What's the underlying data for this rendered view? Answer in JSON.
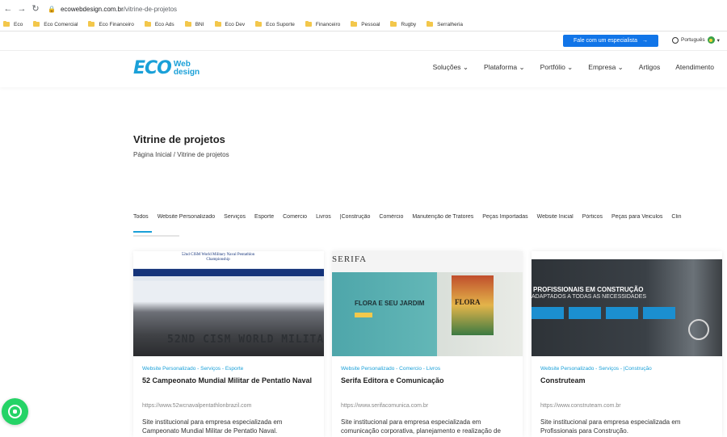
{
  "browser": {
    "url_host": "ecowebdesign.com.br",
    "url_path": "/vitrine-de-projetos",
    "bookmarks": [
      "Eco",
      "Eco Comercial",
      "Eco Financeiro",
      "Eco Ads",
      "BNI",
      "Eco Dev",
      "Eco Suporte",
      "Financeiro",
      "Pessoal",
      "Rugby",
      "Serralheria"
    ]
  },
  "utilbar": {
    "cta_label": "Fale com um especialista",
    "cta_arrow": "→",
    "language": "Português",
    "chevron": "▾"
  },
  "brand": {
    "logo_main": "ECO",
    "logo_line1": "Web",
    "logo_line2": "design",
    "accent_color": "#1aa0d8"
  },
  "menu": [
    "Soluções ⌄",
    "Plataforma ⌄",
    "Portfólio ⌄",
    "Empresa ⌄",
    "Artigos",
    "Atendimento"
  ],
  "page": {
    "title": "Vitrine de projetos",
    "breadcrumb": "Página Inicial / Vitrine de projetos"
  },
  "filters": [
    "Todos",
    "Website Personalizado",
    "Serviços",
    "Esporte",
    "Comercio",
    "Livros",
    "|Construção",
    "Comércio",
    "Manutenção de Tratores",
    "Peças Importadas",
    "Website Inicial",
    "Pórticos",
    "Peças para Veiculos",
    "Clin"
  ],
  "cards": [
    {
      "categories": "Website Personalizado - Serviços - Esporte",
      "title": "52 Campeonato Mundial Militar de Pentatlo Naval",
      "url": "https://www.52wcnavalpentathlonbrazil.com",
      "description": "Site institucional para empresa especializada em Campeonato Mundial Militar de Pentatlo Naval.",
      "image": {
        "banner": "52nd CISM World Military Naval Pentathlon Championship",
        "big_text": "52ND CISM WORLD MILITA"
      }
    },
    {
      "categories": "Website Personalizado - Comercio - Livros",
      "title": "Serifa Editora e Comunicação",
      "url": "https://www.serifacomunica.com.br",
      "description": "Site institucional para empresa especializada em comunicação corporativa, planejamento e realização de eventos e edição de livros e revistas.",
      "image": {
        "logo": "SERIFA",
        "headline": "FLORA E SEU JARDIM",
        "poster": "FLORA"
      }
    },
    {
      "categories": "Website Personalizado - Serviços - |Construção",
      "title": "Construteam",
      "url": "https://www.construteam.com.br",
      "description": "Site institucional para empresa especializada em Profissionais para Construção.",
      "image": {
        "headline": "PROFISSIONAIS EM CONSTRUÇÃO",
        "subline": "ADAPTADOS A TODAS AS NECESSIDADES"
      }
    }
  ]
}
